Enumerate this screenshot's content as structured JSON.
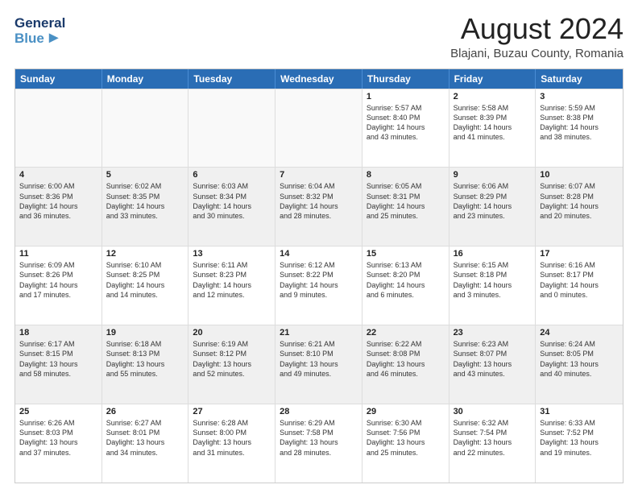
{
  "logo": {
    "general": "General",
    "blue": "Blue"
  },
  "title": "August 2024",
  "subtitle": "Blajani, Buzau County, Romania",
  "header_days": [
    "Sunday",
    "Monday",
    "Tuesday",
    "Wednesday",
    "Thursday",
    "Friday",
    "Saturday"
  ],
  "rows": [
    [
      {
        "num": "",
        "detail": "",
        "empty": true
      },
      {
        "num": "",
        "detail": "",
        "empty": true
      },
      {
        "num": "",
        "detail": "",
        "empty": true
      },
      {
        "num": "",
        "detail": "",
        "empty": true
      },
      {
        "num": "1",
        "detail": "Sunrise: 5:57 AM\nSunset: 8:40 PM\nDaylight: 14 hours\nand 43 minutes."
      },
      {
        "num": "2",
        "detail": "Sunrise: 5:58 AM\nSunset: 8:39 PM\nDaylight: 14 hours\nand 41 minutes."
      },
      {
        "num": "3",
        "detail": "Sunrise: 5:59 AM\nSunset: 8:38 PM\nDaylight: 14 hours\nand 38 minutes."
      }
    ],
    [
      {
        "num": "4",
        "detail": "Sunrise: 6:00 AM\nSunset: 8:36 PM\nDaylight: 14 hours\nand 36 minutes.",
        "shaded": true
      },
      {
        "num": "5",
        "detail": "Sunrise: 6:02 AM\nSunset: 8:35 PM\nDaylight: 14 hours\nand 33 minutes.",
        "shaded": true
      },
      {
        "num": "6",
        "detail": "Sunrise: 6:03 AM\nSunset: 8:34 PM\nDaylight: 14 hours\nand 30 minutes.",
        "shaded": true
      },
      {
        "num": "7",
        "detail": "Sunrise: 6:04 AM\nSunset: 8:32 PM\nDaylight: 14 hours\nand 28 minutes.",
        "shaded": true
      },
      {
        "num": "8",
        "detail": "Sunrise: 6:05 AM\nSunset: 8:31 PM\nDaylight: 14 hours\nand 25 minutes.",
        "shaded": true
      },
      {
        "num": "9",
        "detail": "Sunrise: 6:06 AM\nSunset: 8:29 PM\nDaylight: 14 hours\nand 23 minutes.",
        "shaded": true
      },
      {
        "num": "10",
        "detail": "Sunrise: 6:07 AM\nSunset: 8:28 PM\nDaylight: 14 hours\nand 20 minutes.",
        "shaded": true
      }
    ],
    [
      {
        "num": "11",
        "detail": "Sunrise: 6:09 AM\nSunset: 8:26 PM\nDaylight: 14 hours\nand 17 minutes."
      },
      {
        "num": "12",
        "detail": "Sunrise: 6:10 AM\nSunset: 8:25 PM\nDaylight: 14 hours\nand 14 minutes."
      },
      {
        "num": "13",
        "detail": "Sunrise: 6:11 AM\nSunset: 8:23 PM\nDaylight: 14 hours\nand 12 minutes."
      },
      {
        "num": "14",
        "detail": "Sunrise: 6:12 AM\nSunset: 8:22 PM\nDaylight: 14 hours\nand 9 minutes."
      },
      {
        "num": "15",
        "detail": "Sunrise: 6:13 AM\nSunset: 8:20 PM\nDaylight: 14 hours\nand 6 minutes."
      },
      {
        "num": "16",
        "detail": "Sunrise: 6:15 AM\nSunset: 8:18 PM\nDaylight: 14 hours\nand 3 minutes."
      },
      {
        "num": "17",
        "detail": "Sunrise: 6:16 AM\nSunset: 8:17 PM\nDaylight: 14 hours\nand 0 minutes."
      }
    ],
    [
      {
        "num": "18",
        "detail": "Sunrise: 6:17 AM\nSunset: 8:15 PM\nDaylight: 13 hours\nand 58 minutes.",
        "shaded": true
      },
      {
        "num": "19",
        "detail": "Sunrise: 6:18 AM\nSunset: 8:13 PM\nDaylight: 13 hours\nand 55 minutes.",
        "shaded": true
      },
      {
        "num": "20",
        "detail": "Sunrise: 6:19 AM\nSunset: 8:12 PM\nDaylight: 13 hours\nand 52 minutes.",
        "shaded": true
      },
      {
        "num": "21",
        "detail": "Sunrise: 6:21 AM\nSunset: 8:10 PM\nDaylight: 13 hours\nand 49 minutes.",
        "shaded": true
      },
      {
        "num": "22",
        "detail": "Sunrise: 6:22 AM\nSunset: 8:08 PM\nDaylight: 13 hours\nand 46 minutes.",
        "shaded": true
      },
      {
        "num": "23",
        "detail": "Sunrise: 6:23 AM\nSunset: 8:07 PM\nDaylight: 13 hours\nand 43 minutes.",
        "shaded": true
      },
      {
        "num": "24",
        "detail": "Sunrise: 6:24 AM\nSunset: 8:05 PM\nDaylight: 13 hours\nand 40 minutes.",
        "shaded": true
      }
    ],
    [
      {
        "num": "25",
        "detail": "Sunrise: 6:26 AM\nSunset: 8:03 PM\nDaylight: 13 hours\nand 37 minutes."
      },
      {
        "num": "26",
        "detail": "Sunrise: 6:27 AM\nSunset: 8:01 PM\nDaylight: 13 hours\nand 34 minutes."
      },
      {
        "num": "27",
        "detail": "Sunrise: 6:28 AM\nSunset: 8:00 PM\nDaylight: 13 hours\nand 31 minutes."
      },
      {
        "num": "28",
        "detail": "Sunrise: 6:29 AM\nSunset: 7:58 PM\nDaylight: 13 hours\nand 28 minutes."
      },
      {
        "num": "29",
        "detail": "Sunrise: 6:30 AM\nSunset: 7:56 PM\nDaylight: 13 hours\nand 25 minutes."
      },
      {
        "num": "30",
        "detail": "Sunrise: 6:32 AM\nSunset: 7:54 PM\nDaylight: 13 hours\nand 22 minutes."
      },
      {
        "num": "31",
        "detail": "Sunrise: 6:33 AM\nSunset: 7:52 PM\nDaylight: 13 hours\nand 19 minutes."
      }
    ]
  ]
}
